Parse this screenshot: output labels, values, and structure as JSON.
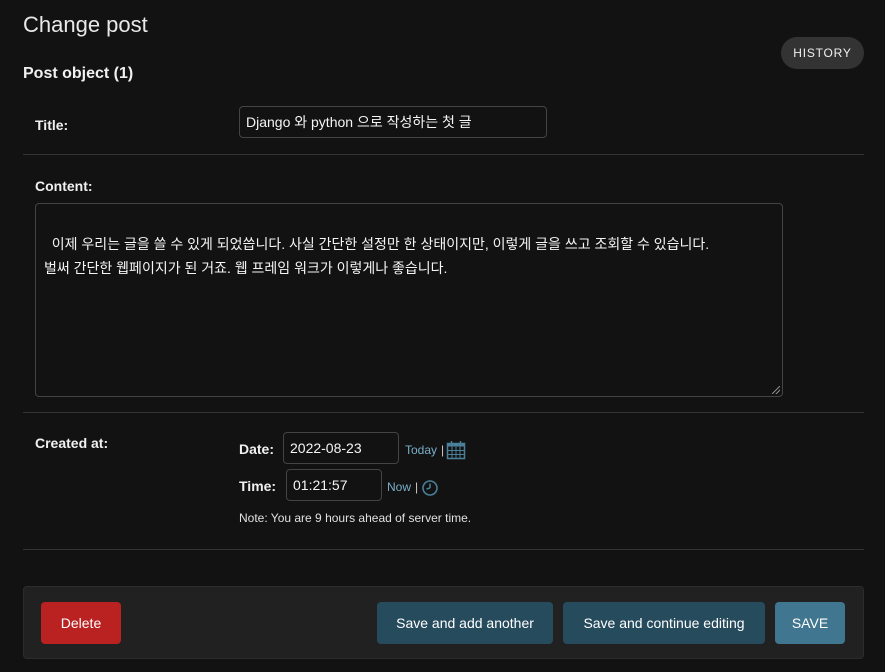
{
  "header": {
    "title": "Change post",
    "history_label": "HISTORY"
  },
  "form": {
    "section_title": "Post object (1)",
    "title_label": "Title:",
    "title_value": "Django 와 python 으로 작성하는 첫 글",
    "content_label": "Content:",
    "content_value": "이제 우리는 글을 쓸 수 있게 되었씁니다. 사실 간단한 설정만 한 상태이지만, 이렇게 글을 쓰고 조회할 수 있습니다.\n벌써 간단한 웹페이지가 된 거죠. 웹 프레임 워크가 이렇게나 좋습니다.",
    "created_label": "Created at:",
    "date_label": "Date:",
    "date_value": "2022-08-23",
    "today_link": "Today",
    "time_label": "Time:",
    "time_value": "01:21:57",
    "now_link": "Now",
    "separator": "|",
    "note": "Note: You are 9 hours ahead of server time."
  },
  "actions": {
    "delete_label": "Delete",
    "save_add_label": "Save and add another",
    "save_continue_label": "Save and continue editing",
    "save_label": "SAVE"
  },
  "icons": {
    "date": "calendar-icon",
    "time": "clock-icon"
  },
  "colors": {
    "background": "#121212",
    "link": "#79aec8",
    "delete": "#ba2121",
    "secondary_button": "#264b5d",
    "primary_button": "#417690"
  }
}
